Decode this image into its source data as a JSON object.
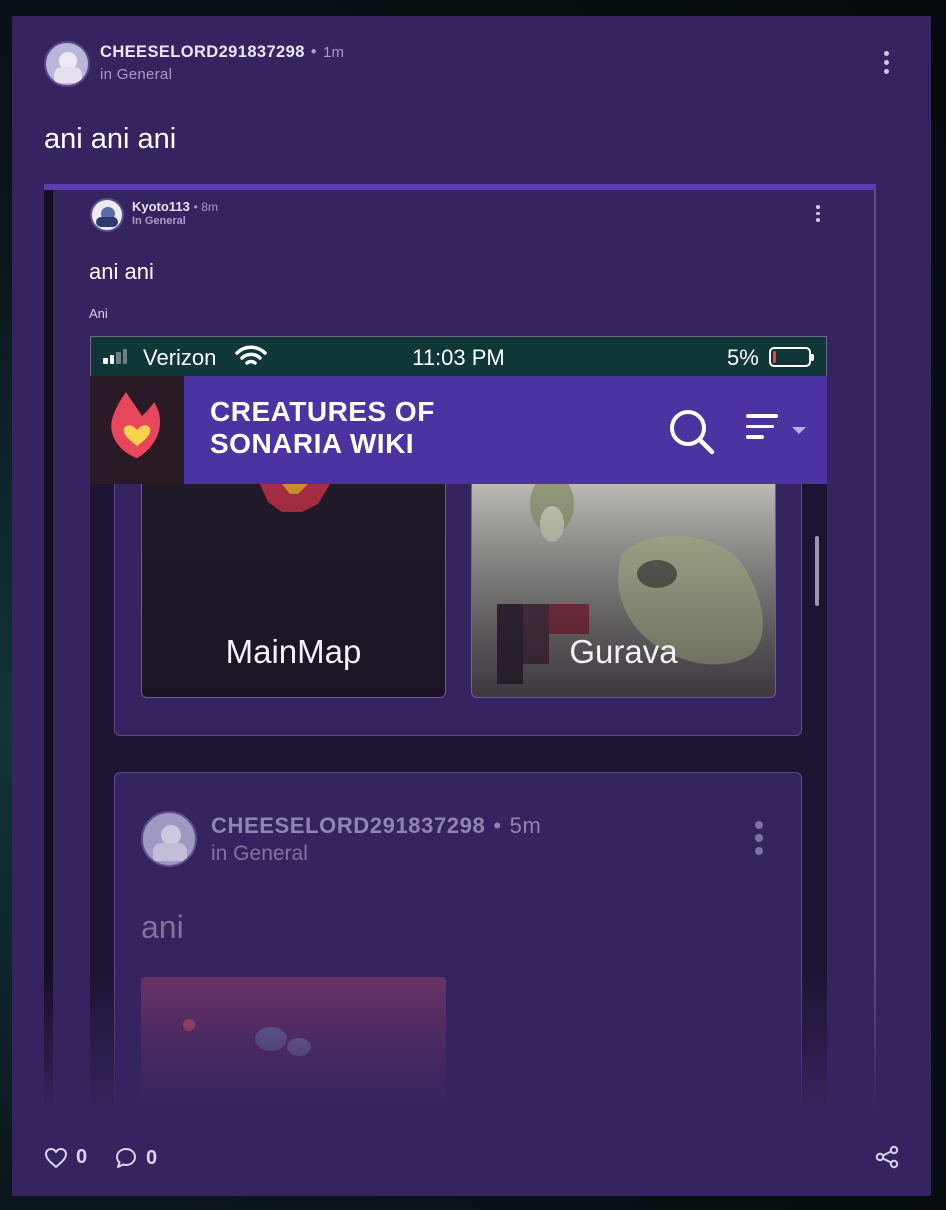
{
  "post": {
    "author": "CHEESELORD291837298",
    "separator": "•",
    "time": "1m",
    "community": "in General",
    "title": "ani ani ani",
    "likes": "0",
    "comments": "0"
  },
  "embedded": {
    "author": "Kyoto113",
    "separator": "•",
    "time": "8m",
    "community": "In General",
    "title": "ani ani",
    "body": "Ani",
    "phone": {
      "carrier": "Verizon",
      "clock": "11:03 PM",
      "battery_pct": "5%",
      "wiki_title_line1": "CREATURES OF",
      "wiki_title_line2": "SONARIA WIKI",
      "tiles": [
        {
          "label": "MainMap"
        },
        {
          "label": "Gurava"
        }
      ],
      "nested_post": {
        "author": "CHEESELORD291837298",
        "separator": "•",
        "time": "5m",
        "community": "in General",
        "title": "ani"
      }
    }
  },
  "colors": {
    "card_bg": "#35245f",
    "wiki_bar": "#4c33a2",
    "accent_bar": "#5a3fb0",
    "text_muted": "#a79cc8"
  },
  "icons": {
    "more": "more-vertical-icon",
    "like": "heart-icon",
    "comment": "comment-icon",
    "share": "share-icon",
    "search": "search-icon",
    "menu": "menu-icon",
    "wifi": "wifi-icon",
    "logo": "fandom-flame-logo"
  }
}
